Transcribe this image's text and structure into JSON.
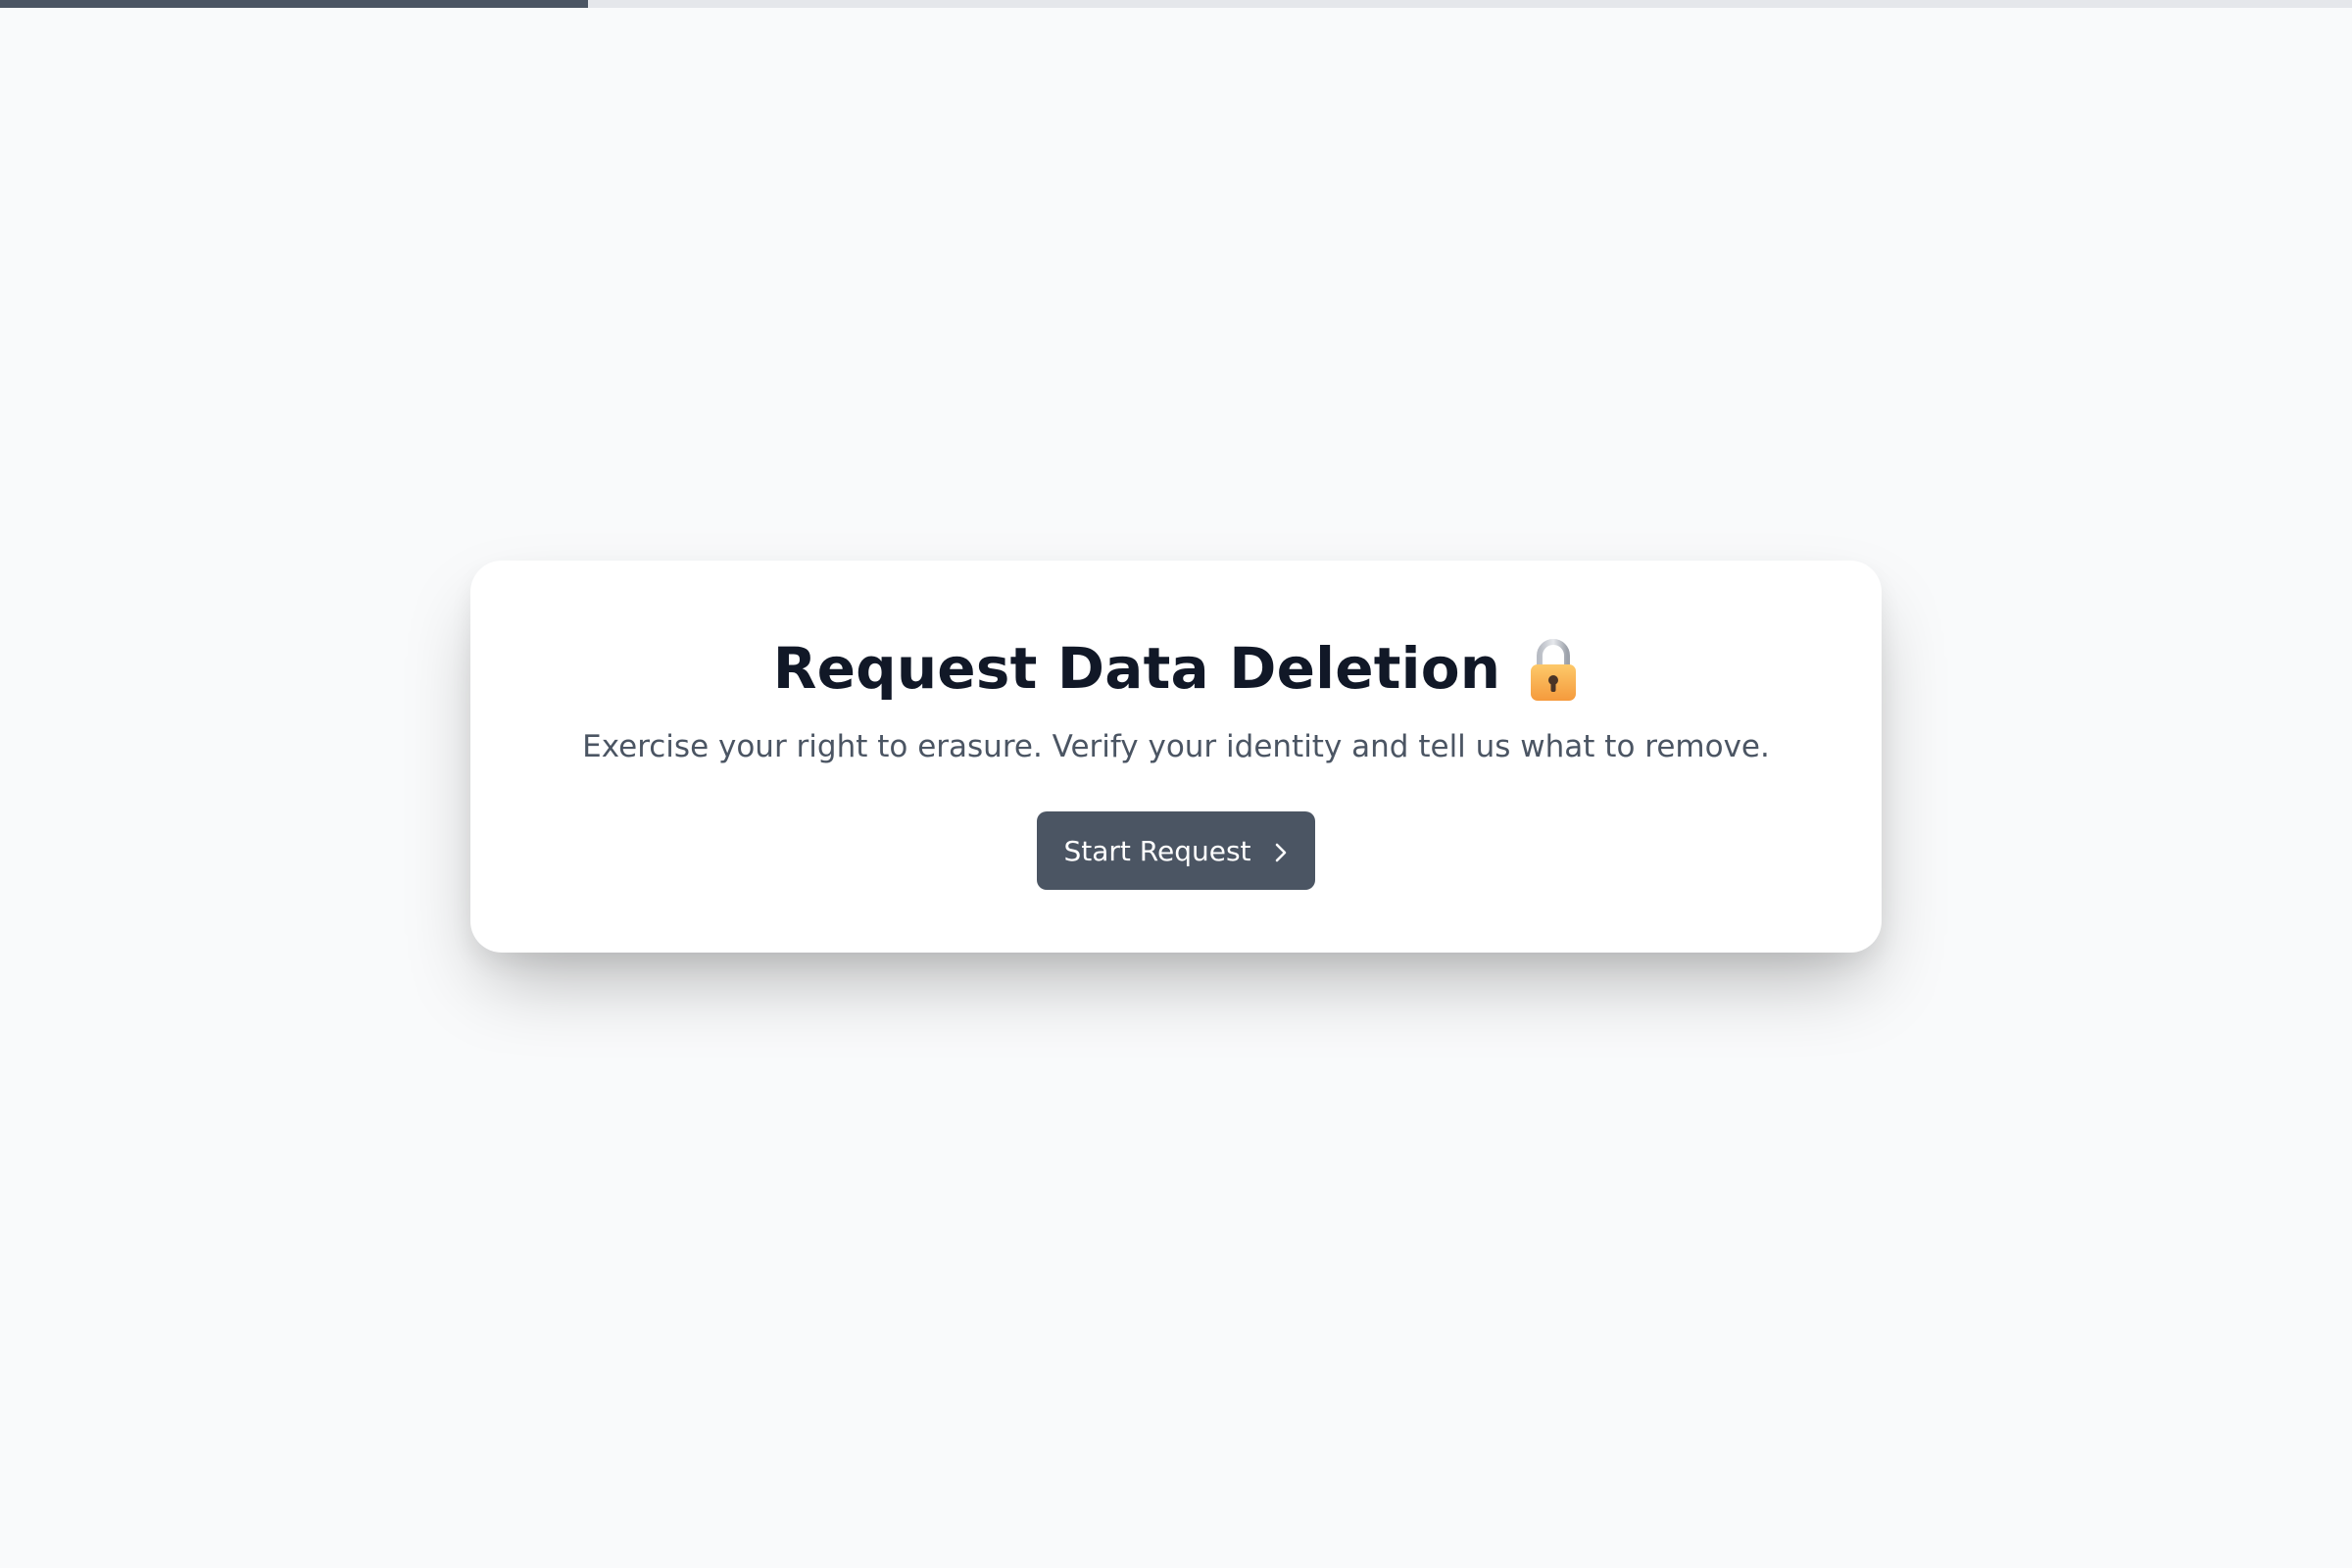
{
  "progress": {
    "value_percent": 25,
    "fill_color": "#4b5563",
    "track_color": "#e5e7eb"
  },
  "card": {
    "title": "Request Data Deletion",
    "title_icon": "lock-icon",
    "subtitle": "Exercise your right to erasure. Verify your identity and tell us what to remove.",
    "start_button_label": "Start Request",
    "start_button_icon": "chevron-right-icon"
  },
  "colors": {
    "background": "#f9fafb",
    "button": "#4b5563",
    "title": "#111827",
    "subtitle": "#4b5563"
  }
}
